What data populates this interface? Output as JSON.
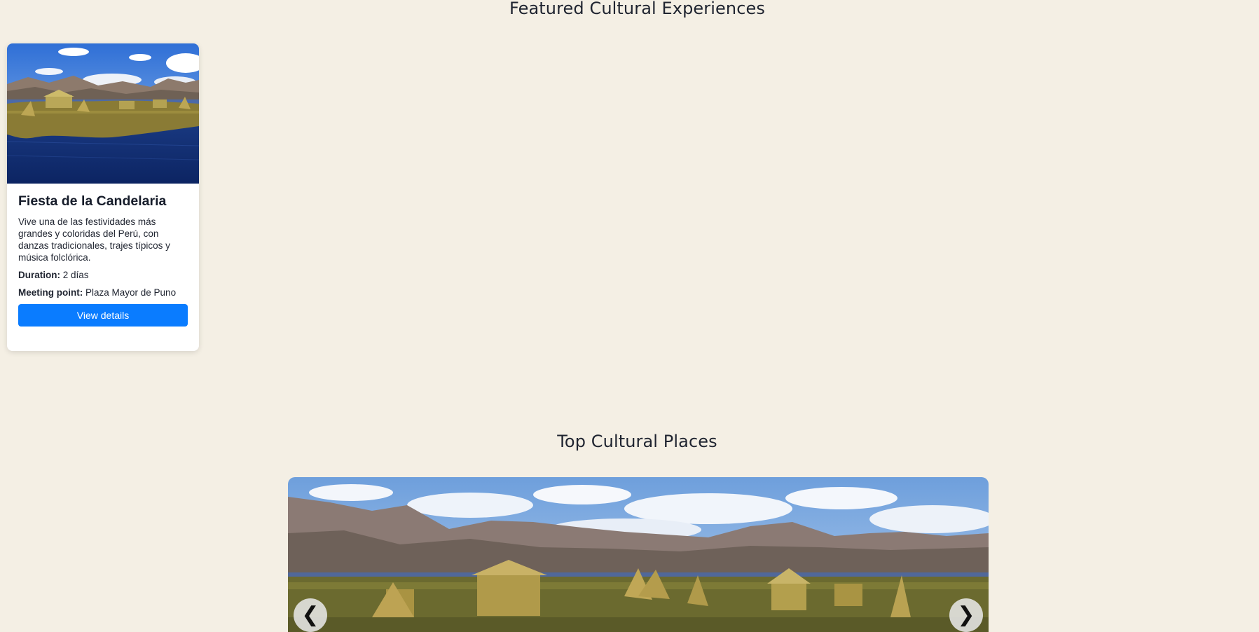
{
  "sections": {
    "featured_title": "Featured Cultural Experiences",
    "places_title": "Top Cultural Places"
  },
  "experience_card": {
    "title": "Fiesta de la Candelaria",
    "description": "Vive una de las festividades más grandes y coloridas del Perú, con danzas tradicionales, trajes típicos y música folclórica.",
    "duration_label": "Duration:",
    "duration_value": "2 días",
    "meeting_label": "Meeting point:",
    "meeting_value": "Plaza Mayor de Puno",
    "button_label": "View details"
  },
  "carousel": {
    "prev_label": "❮",
    "next_label": "❯"
  },
  "colors": {
    "page_background": "#f4efe4",
    "button_blue": "#0a7cff",
    "card_background": "#ffffff"
  }
}
